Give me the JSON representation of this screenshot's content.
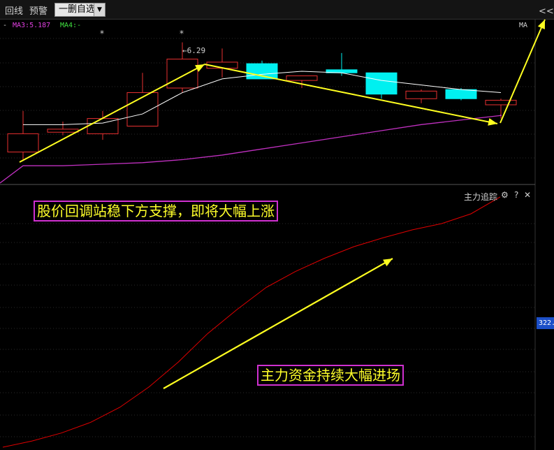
{
  "toolbar": {
    "item1": "回线",
    "item2": "预警",
    "dropdown_label": "一删自选",
    "dropdown_arrow": "▼",
    "right_label": "<<展"
  },
  "indicators": {
    "dash": "-",
    "ma3": "MA3:5.187",
    "ma4": "MA4:-",
    "ma_label": "MA",
    "star": "*",
    "peak": "←6.29",
    "ma3_color": "#e040e0",
    "ma4_color": "#40e040"
  },
  "sub_panel": {
    "title": "主力追踪",
    "gear_icon": "⚙",
    "help_icon": "?",
    "close_icon": "✕",
    "price_tag": "322."
  },
  "callouts": {
    "top": "股价回调站稳下方支撑，即将大幅上涨",
    "bottom": "主力资金持续大幅进场"
  },
  "colors": {
    "up": "#e83030",
    "down": "#00f0f0",
    "ma_white": "#ffffff",
    "ma_magenta": "#c030c0",
    "fund_line": "#e00000",
    "arrow": "#ffff20",
    "callout_border": "#d030d0"
  },
  "chart_data": {
    "type": "candlestick",
    "candles": [
      {
        "open": 5.38,
        "close": 5.5,
        "high": 5.65,
        "low": 5.33
      },
      {
        "open": 5.51,
        "close": 5.53,
        "high": 5.58,
        "low": 5.49
      },
      {
        "open": 5.5,
        "close": 5.6,
        "high": 5.65,
        "low": 5.46
      },
      {
        "open": 5.55,
        "close": 5.77,
        "high": 5.9,
        "low": 5.55
      },
      {
        "open": 5.8,
        "close": 5.99,
        "high": 6.1,
        "low": 5.77
      },
      {
        "open": 5.93,
        "close": 5.97,
        "high": 6.06,
        "low": 5.87
      },
      {
        "open": 5.96,
        "close": 5.86,
        "high": 5.98,
        "low": 5.86
      },
      {
        "open": 5.85,
        "close": 5.88,
        "high": 5.88,
        "low": 5.8
      },
      {
        "open": 5.92,
        "close": 5.9,
        "high": 6.03,
        "low": 5.88
      },
      {
        "open": 5.9,
        "close": 5.76,
        "high": 5.9,
        "low": 5.73
      },
      {
        "open": 5.73,
        "close": 5.78,
        "high": 5.79,
        "low": 5.7
      },
      {
        "open": 5.79,
        "close": 5.73,
        "high": 5.8,
        "low": 5.72
      },
      {
        "open": 5.69,
        "close": 5.72,
        "high": 5.73,
        "low": 5.6
      }
    ],
    "ma_white": [
      5.56,
      5.56,
      5.57,
      5.63,
      5.77,
      5.86,
      5.89,
      5.91,
      5.9,
      5.85,
      5.82,
      5.79,
      5.77
    ],
    "ma_magenta": [
      5.29,
      5.29,
      5.3,
      5.31,
      5.33,
      5.36,
      5.4,
      5.44,
      5.48,
      5.52,
      5.56,
      5.59,
      5.62
    ],
    "fund_line": [
      0,
      7,
      16,
      28,
      45,
      68,
      96,
      128,
      155,
      180,
      198,
      213,
      226,
      236,
      245,
      252,
      263,
      282
    ]
  }
}
